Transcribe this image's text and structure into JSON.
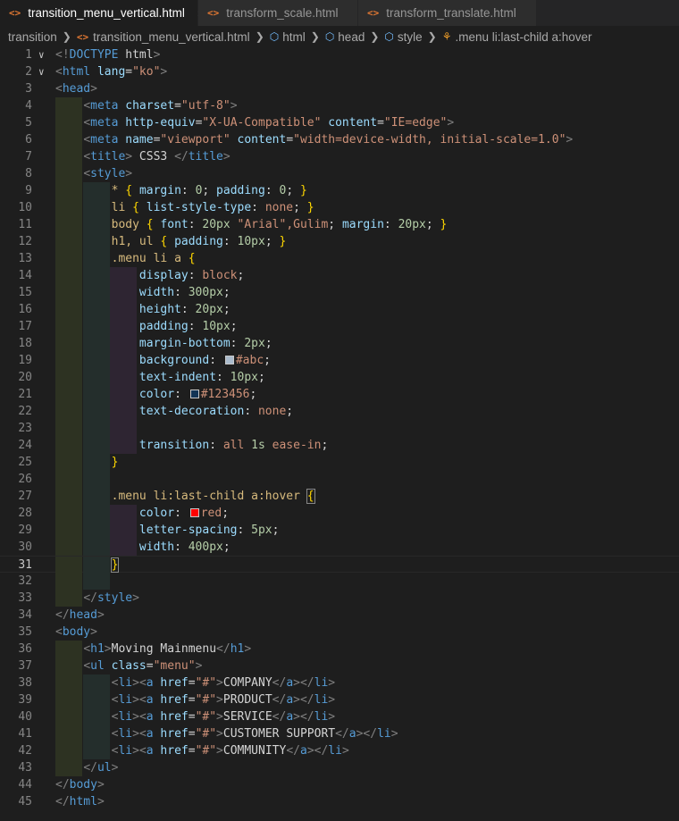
{
  "tabs": [
    {
      "label": "transition_menu_vertical.html",
      "active": true,
      "close": "×"
    },
    {
      "label": "transform_scale.html",
      "active": false
    },
    {
      "label": "transform_translate.html",
      "active": false
    }
  ],
  "breadcrumb": [
    "transition",
    "transition_menu_vertical.html",
    "html",
    "head",
    "style",
    ".menu li:last-child a:hover"
  ],
  "current_line": 31,
  "colors": {
    "abc": "#aabbcc",
    "123456": "#123456",
    "red": "#ff0000"
  },
  "lines": [
    "<!DOCTYPE html>",
    "<html lang=\"ko\">",
    "<head>",
    "    <meta charset=\"utf-8\">",
    "    <meta http-equiv=\"X-UA-Compatible\" content=\"IE=edge\">",
    "    <meta name=\"viewport\" content=\"width=device-width, initial-scale=1.0\">",
    "    <title> CSS3 </title>",
    "    <style>",
    "        * { margin: 0; padding: 0; }",
    "        li { list-style-type: none; }",
    "        body { font: 20px \"Arial\",Gulim; margin: 20px; }",
    "        h1, ul { padding: 10px; }",
    "        .menu li a {",
    "            display: block;",
    "            width: 300px;",
    "            height: 20px;",
    "            padding: 10px;",
    "            margin-bottom: 2px;",
    "            background: #abc;",
    "            text-indent: 10px;",
    "            color: #123456;",
    "            text-decoration: none;",
    "",
    "            transition: all 1s ease-in;",
    "        }",
    "",
    "        .menu li:last-child a:hover {",
    "            color: red;",
    "            letter-spacing: 5px;",
    "            width: 400px;",
    "        }",
    "",
    "    </style>",
    "</head>",
    "<body>",
    "    <h1>Moving Mainmenu</h1>",
    "    <ul class=\"menu\">",
    "        <li><a href=\"#\">COMPANY</a></li>",
    "        <li><a href=\"#\">PRODUCT</a></li>",
    "        <li><a href=\"#\">SERVICE</a></li>",
    "        <li><a href=\"#\">CUSTOMER SUPPORT</a></li>",
    "        <li><a href=\"#\">COMMUNITY</a></li>",
    "    </ul>",
    "</body>",
    "</html>"
  ]
}
